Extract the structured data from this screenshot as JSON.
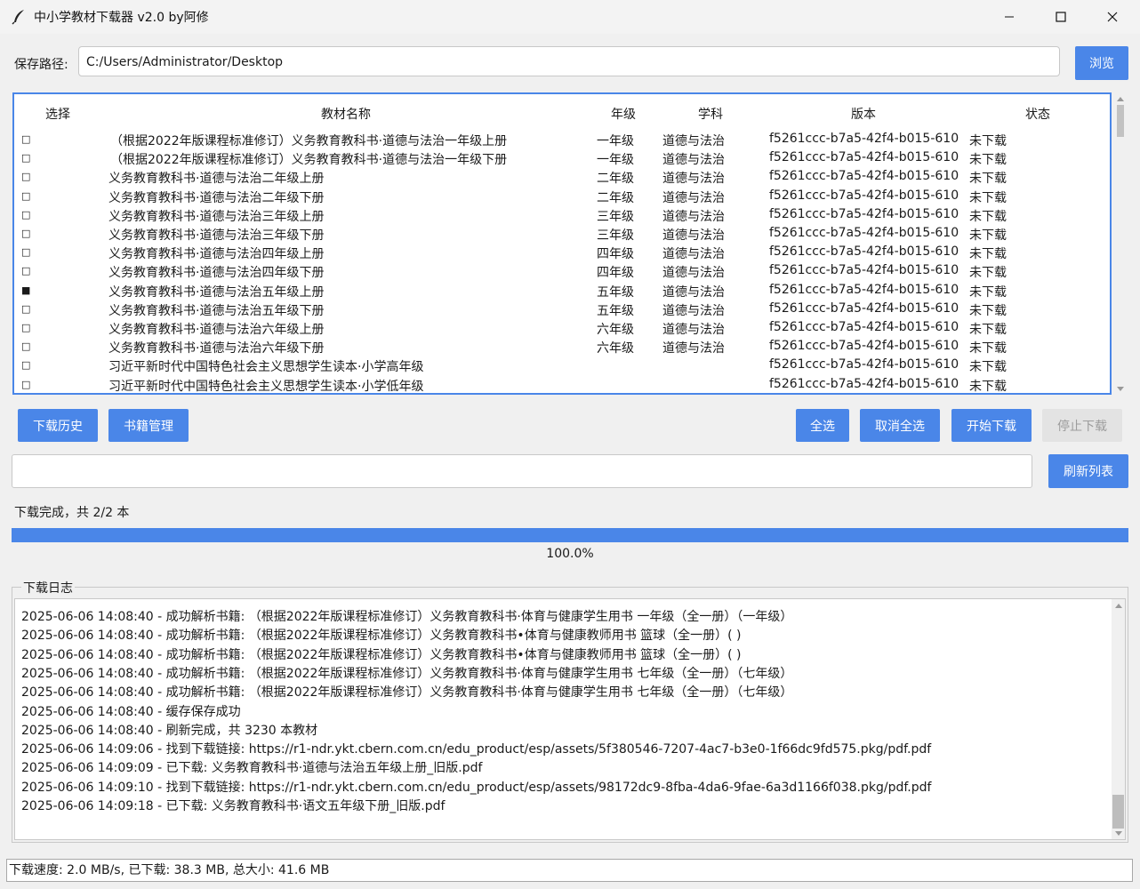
{
  "window": {
    "title": "中小学教材下载器 v2.0 by阿修",
    "app_icon": "feather-icon",
    "controls": [
      "minimize-icon",
      "maximize-icon",
      "close-icon"
    ]
  },
  "save": {
    "label": "保存路径:",
    "path": "C:/Users/Administrator/Desktop",
    "browse_label": "浏览"
  },
  "table": {
    "columns": [
      "选择",
      "教材名称",
      "年级",
      "学科",
      "版本",
      "状态"
    ],
    "rows": [
      {
        "checked": false,
        "name": "（根据2022年版课程标准修订）义务教育教科书·道德与法治一年级上册",
        "grade": "一年级",
        "subject": "道德与法治",
        "version": "f5261ccc-b7a5-42f4-b015-610",
        "status": "未下载"
      },
      {
        "checked": false,
        "name": "（根据2022年版课程标准修订）义务教育教科书·道德与法治一年级下册",
        "grade": "一年级",
        "subject": "道德与法治",
        "version": "f5261ccc-b7a5-42f4-b015-610",
        "status": "未下载"
      },
      {
        "checked": false,
        "name": "义务教育教科书·道德与法治二年级上册",
        "grade": "二年级",
        "subject": "道德与法治",
        "version": "f5261ccc-b7a5-42f4-b015-610",
        "status": "未下载"
      },
      {
        "checked": false,
        "name": "义务教育教科书·道德与法治二年级下册",
        "grade": "二年级",
        "subject": "道德与法治",
        "version": "f5261ccc-b7a5-42f4-b015-610",
        "status": "未下载"
      },
      {
        "checked": false,
        "name": "义务教育教科书·道德与法治三年级上册",
        "grade": "三年级",
        "subject": "道德与法治",
        "version": "f5261ccc-b7a5-42f4-b015-610",
        "status": "未下载"
      },
      {
        "checked": false,
        "name": "义务教育教科书·道德与法治三年级下册",
        "grade": "三年级",
        "subject": "道德与法治",
        "version": "f5261ccc-b7a5-42f4-b015-610",
        "status": "未下载"
      },
      {
        "checked": false,
        "name": "义务教育教科书·道德与法治四年级上册",
        "grade": "四年级",
        "subject": "道德与法治",
        "version": "f5261ccc-b7a5-42f4-b015-610",
        "status": "未下载"
      },
      {
        "checked": false,
        "name": "义务教育教科书·道德与法治四年级下册",
        "grade": "四年级",
        "subject": "道德与法治",
        "version": "f5261ccc-b7a5-42f4-b015-610",
        "status": "未下载"
      },
      {
        "checked": true,
        "name": "义务教育教科书·道德与法治五年级上册",
        "grade": "五年级",
        "subject": "道德与法治",
        "version": "f5261ccc-b7a5-42f4-b015-610",
        "status": "未下载"
      },
      {
        "checked": false,
        "name": "义务教育教科书·道德与法治五年级下册",
        "grade": "五年级",
        "subject": "道德与法治",
        "version": "f5261ccc-b7a5-42f4-b015-610",
        "status": "未下载"
      },
      {
        "checked": false,
        "name": "义务教育教科书·道德与法治六年级上册",
        "grade": "六年级",
        "subject": "道德与法治",
        "version": "f5261ccc-b7a5-42f4-b015-610",
        "status": "未下载"
      },
      {
        "checked": false,
        "name": "义务教育教科书·道德与法治六年级下册",
        "grade": "六年级",
        "subject": "道德与法治",
        "version": "f5261ccc-b7a5-42f4-b015-610",
        "status": "未下载"
      },
      {
        "checked": false,
        "name": "习近平新时代中国特色社会主义思想学生读本·小学高年级",
        "grade": "",
        "subject": "",
        "version": "f5261ccc-b7a5-42f4-b015-610",
        "status": "未下载"
      },
      {
        "checked": false,
        "name": "习近平新时代中国特色社会主义思想学生读本·小学低年级",
        "grade": "",
        "subject": "",
        "version": "f5261ccc-b7a5-42f4-b015-610",
        "status": "未下载"
      }
    ]
  },
  "toolbar": {
    "history_label": "下载历史",
    "books_label": "书籍管理",
    "select_all_label": "全选",
    "deselect_all_label": "取消全选",
    "start_label": "开始下载",
    "stop_label": "停止下载",
    "refresh_label": "刷新列表"
  },
  "filter": {
    "value": ""
  },
  "status": {
    "text": "下载完成，共 2/2 本",
    "progress": 1.0,
    "progress_label": "100.0%"
  },
  "log": {
    "title": "下载日志",
    "lines": [
      "2025-06-06 14:08:40 - 成功解析书籍: （根据2022年版课程标准修订）义务教育教科书·体育与健康学生用书 一年级（全一册）（一年级）",
      "2025-06-06 14:08:40 - 成功解析书籍: （根据2022年版课程标准修订）义务教育教科书•体育与健康教师用书 篮球（全一册）( )",
      "2025-06-06 14:08:40 - 成功解析书籍: （根据2022年版课程标准修订）义务教育教科书•体育与健康教师用书 篮球（全一册）( )",
      "2025-06-06 14:08:40 - 成功解析书籍: （根据2022年版课程标准修订）义务教育教科书·体育与健康学生用书 七年级（全一册）（七年级）",
      "2025-06-06 14:08:40 - 成功解析书籍: （根据2022年版课程标准修订）义务教育教科书·体育与健康学生用书 七年级（全一册）（七年级）",
      "2025-06-06 14:08:40 - 缓存保存成功",
      "2025-06-06 14:08:40 - 刷新完成，共 3230 本教材",
      "2025-06-06 14:09:06 - 找到下载链接: https://r1-ndr.ykt.cbern.com.cn/edu_product/esp/assets/5f380546-7207-4ac7-b3e0-1f66dc9fd575.pkg/pdf.pdf",
      "2025-06-06 14:09:09 - 已下载: 义务教育教科书·道德与法治五年级上册_旧版.pdf",
      "2025-06-06 14:09:10 - 找到下载链接: https://r1-ndr.ykt.cbern.com.cn/edu_product/esp/assets/98172dc9-8fba-4da6-9fae-6a3d1166f038.pkg/pdf.pdf",
      "2025-06-06 14:09:18 - 已下载: 义务教育教科书·语文五年级下册_旧版.pdf"
    ]
  },
  "footer": {
    "text": "下载速度: 2.0 MB/s, 已下载: 38.3 MB, 总大小: 41.6 MB"
  },
  "colors": {
    "accent": "#4a86e8",
    "disabled_bg": "#e3e3e3"
  }
}
